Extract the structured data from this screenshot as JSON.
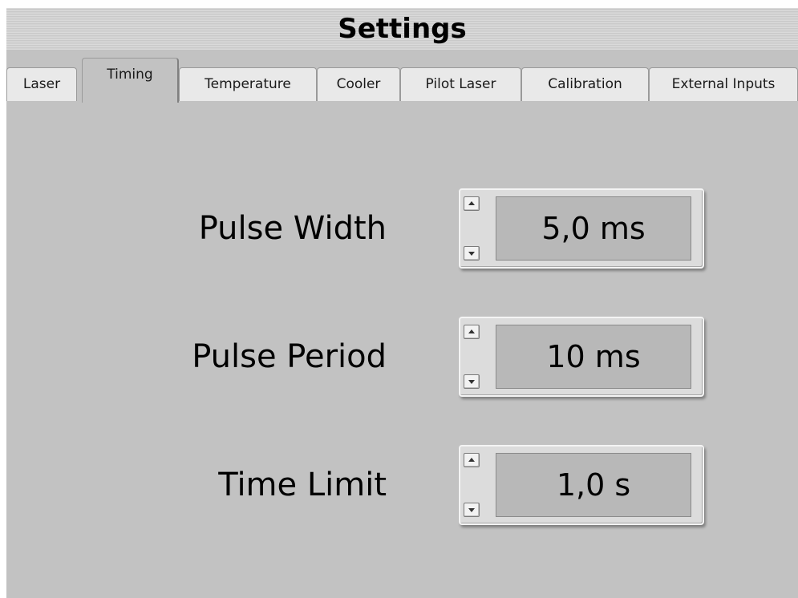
{
  "window": {
    "title": "Settings"
  },
  "tabs": [
    {
      "label": "Laser",
      "active": false
    },
    {
      "label": "Timing",
      "active": true
    },
    {
      "label": "Temperature",
      "active": false
    },
    {
      "label": "Cooler",
      "active": false
    },
    {
      "label": "Pilot Laser",
      "active": false
    },
    {
      "label": "Calibration",
      "active": false
    },
    {
      "label": "External Inputs",
      "active": false
    }
  ],
  "fields": [
    {
      "label": "Pulse Width",
      "value": "5,0 ms"
    },
    {
      "label": "Pulse Period",
      "value": "10 ms"
    },
    {
      "label": "Time Limit",
      "value": "1,0 s"
    }
  ],
  "icons": {
    "increment": "triangle-up-icon",
    "decrement": "triangle-down-icon"
  },
  "colors": {
    "panel_background": "#c2c2c2",
    "display_background": "#b8b8b8"
  }
}
